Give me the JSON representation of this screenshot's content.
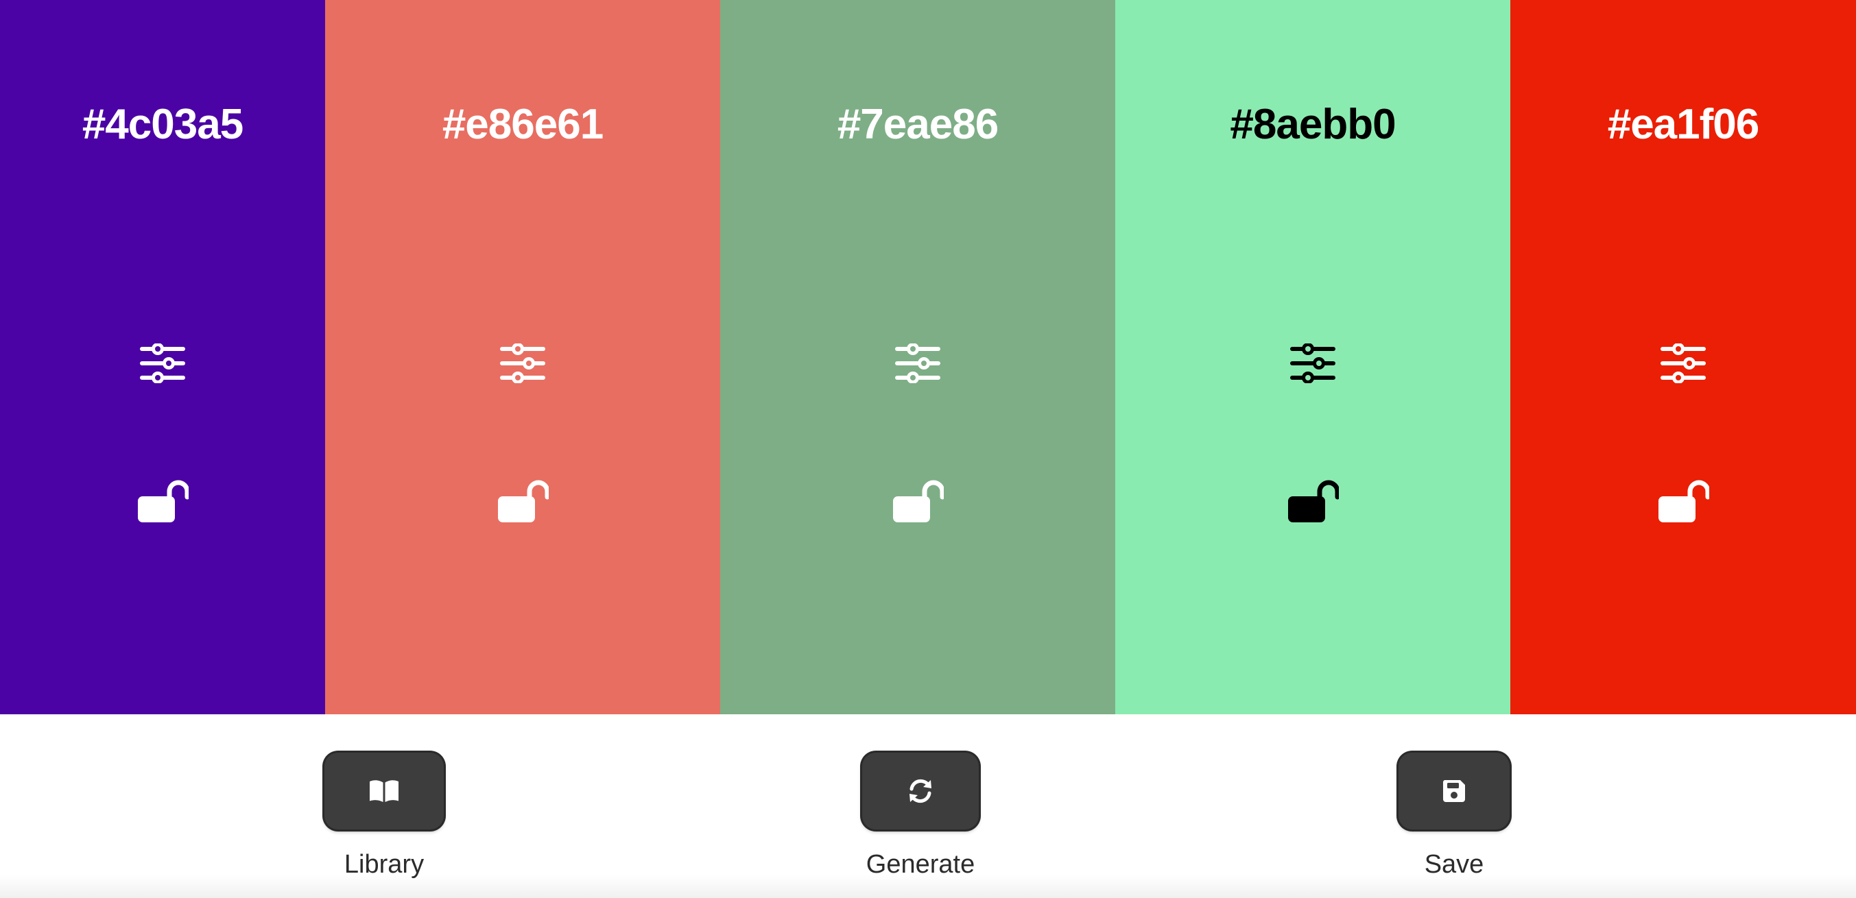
{
  "palette": {
    "colors": [
      {
        "hex": "#4c03a5",
        "text_color": "#ffffff"
      },
      {
        "hex": "#e86e61",
        "text_color": "#ffffff"
      },
      {
        "hex": "#7eae86",
        "text_color": "#ffffff"
      },
      {
        "hex": "#8aebb0",
        "text_color": "#000000"
      },
      {
        "hex": "#ea1f06",
        "text_color": "#ffffff"
      }
    ],
    "adjust_icon": "sliders-icon",
    "lock_icon": "unlocked-padlock-icon"
  },
  "toolbar": {
    "library_label": "Library",
    "library_icon": "book-icon",
    "generate_label": "Generate",
    "generate_icon": "refresh-icon",
    "save_label": "Save",
    "save_icon": "floppy-disk-icon",
    "button_color": "#3d3d3d"
  }
}
